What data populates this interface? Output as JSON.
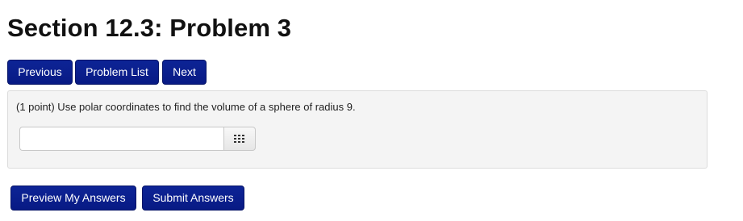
{
  "page": {
    "title": "Section 12.3: Problem 3"
  },
  "nav": {
    "previous_label": "Previous",
    "problem_list_label": "Problem List",
    "next_label": "Next",
    "accent_color": "#0a1f8f"
  },
  "problem": {
    "text": "(1 point) Use polar coordinates to find the volume of a sphere of radius 9.",
    "answer_value": "",
    "keypad_icon": "keypad-grid-icon"
  },
  "actions": {
    "preview_label": "Preview My Answers",
    "submit_label": "Submit Answers"
  }
}
